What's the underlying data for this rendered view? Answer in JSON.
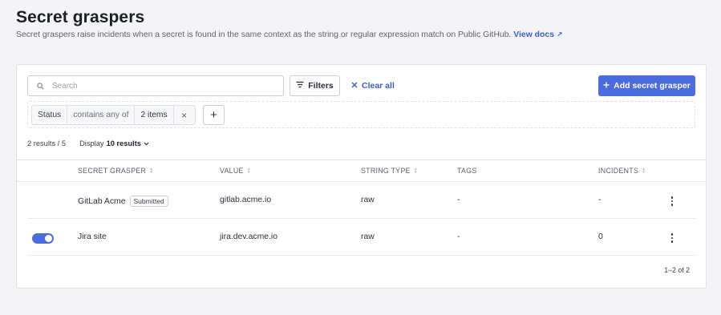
{
  "header": {
    "title": "Secret graspers",
    "description": "Secret graspers raise incidents when a secret is found in the same context as the string or regular expression match on Public GitHub.",
    "docs_link": "View docs"
  },
  "toolbar": {
    "search_placeholder": "Search",
    "filters_label": "Filters",
    "clear_all_label": "Clear all",
    "add_button_label": "Add secret grasper"
  },
  "filter_chip": {
    "field": "Status",
    "operator": "contains any of",
    "value": "2 items"
  },
  "results": {
    "count": "2 results",
    "total": "/ 5",
    "display_label": "Display",
    "display_value": "10 results"
  },
  "table": {
    "columns": [
      "SECRET GRASPER",
      "VALUE",
      "STRING TYPE",
      "TAGS",
      "INCIDENTS"
    ],
    "rows": [
      {
        "name": "GitLab Acme",
        "badge": "Submitted",
        "value": "gitlab.acme.io",
        "string_type": "raw",
        "tags": "-",
        "incidents": "-",
        "enabled": null
      },
      {
        "name": "Jira site",
        "badge": "",
        "value": "jira.dev.acme.io",
        "string_type": "raw",
        "tags": "-",
        "incidents": "0",
        "enabled": true
      }
    ]
  },
  "pagination": "1–2 of 2",
  "colors": {
    "accent": "#4a6cdc",
    "link": "#3b5ccc",
    "background": "#f4f4f6"
  },
  "icons": {
    "search": "search-icon",
    "filter": "filter-icon",
    "clear": "close-icon",
    "add": "plus-icon",
    "external": "external-link-icon",
    "sort": "sort-icon",
    "more": "kebab-icon",
    "chevron": "chevron-down-icon"
  }
}
